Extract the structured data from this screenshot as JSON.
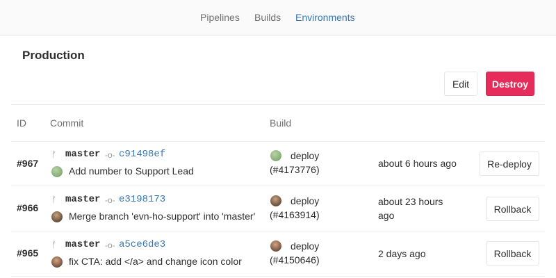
{
  "nav": {
    "tabs": [
      {
        "label": "Pipelines"
      },
      {
        "label": "Builds"
      },
      {
        "label": "Environments"
      }
    ]
  },
  "environment": {
    "title": "Production",
    "edit_label": "Edit",
    "destroy_label": "Destroy"
  },
  "table": {
    "headers": {
      "id": "ID",
      "commit": "Commit",
      "build": "Build"
    },
    "rows": [
      {
        "id": "#967",
        "branch": "master",
        "sha": "c91498ef",
        "message": "Add number to Support Lead",
        "build_name": "deploy",
        "build_id": "(#4173776)",
        "time": "about 6 hours ago",
        "action": "Re-deploy"
      },
      {
        "id": "#966",
        "branch": "master",
        "sha": "e3198173",
        "message": "Merge branch 'evn-ho-support' into 'master'",
        "build_name": "deploy",
        "build_id": "(#4163914)",
        "time": "about 23 hours ago",
        "action": "Rollback"
      },
      {
        "id": "#965",
        "branch": "master",
        "sha": "a5ce6de3",
        "message": "fix CTA: add </a> and change icon color",
        "build_name": "deploy",
        "build_id": "(#4150646)",
        "time": "2 days ago",
        "action": "Rollback"
      }
    ]
  },
  "colors": {
    "link": "#3777b0",
    "danger": "#e52c5a"
  }
}
